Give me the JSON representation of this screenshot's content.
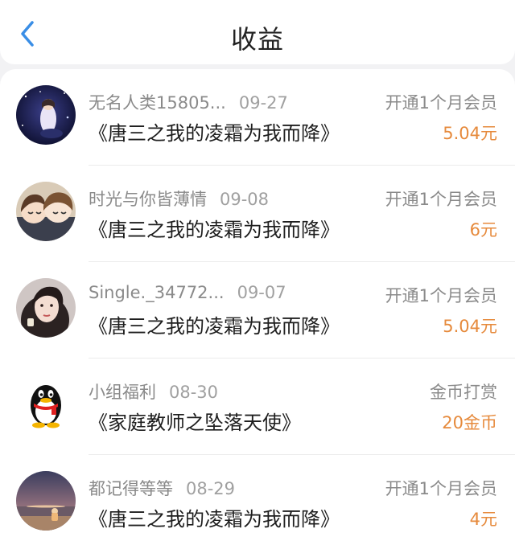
{
  "header": {
    "title": "收益",
    "back_icon": "chevron-left-icon",
    "accent_color": "#3a8ee6"
  },
  "colors": {
    "amount": "#e68a3c",
    "meta_text": "#8a8a8a"
  },
  "items": [
    {
      "name": "无名人类15805...",
      "date": "09-27",
      "book": "《唐三之我的凌霜为我而降》",
      "type": "开通1个月会员",
      "amount": "5.04元",
      "avatar": "night-sky-anime-avatar"
    },
    {
      "name": "时光与你皆薄情",
      "date": "09-08",
      "book": "《唐三之我的凌霜为我而降》",
      "type": "开通1个月会员",
      "amount": "6元",
      "avatar": "anime-couple-avatar"
    },
    {
      "name": "Single._34772...",
      "date": "09-07",
      "book": "《唐三之我的凌霜为我而降》",
      "type": "开通1个月会员",
      "amount": "5.04元",
      "avatar": "girl-portrait-avatar"
    },
    {
      "name": "小组福利",
      "date": "08-30",
      "book": "《家庭教师之坠落天使》",
      "type": "金币打赏",
      "amount": "20金币",
      "avatar": "qq-penguin-avatar"
    },
    {
      "name": "都记得等等",
      "date": "08-29",
      "book": "《唐三之我的凌霜为我而降》",
      "type": "开通1个月会员",
      "amount": "4元",
      "avatar": "sunset-beach-avatar"
    }
  ]
}
